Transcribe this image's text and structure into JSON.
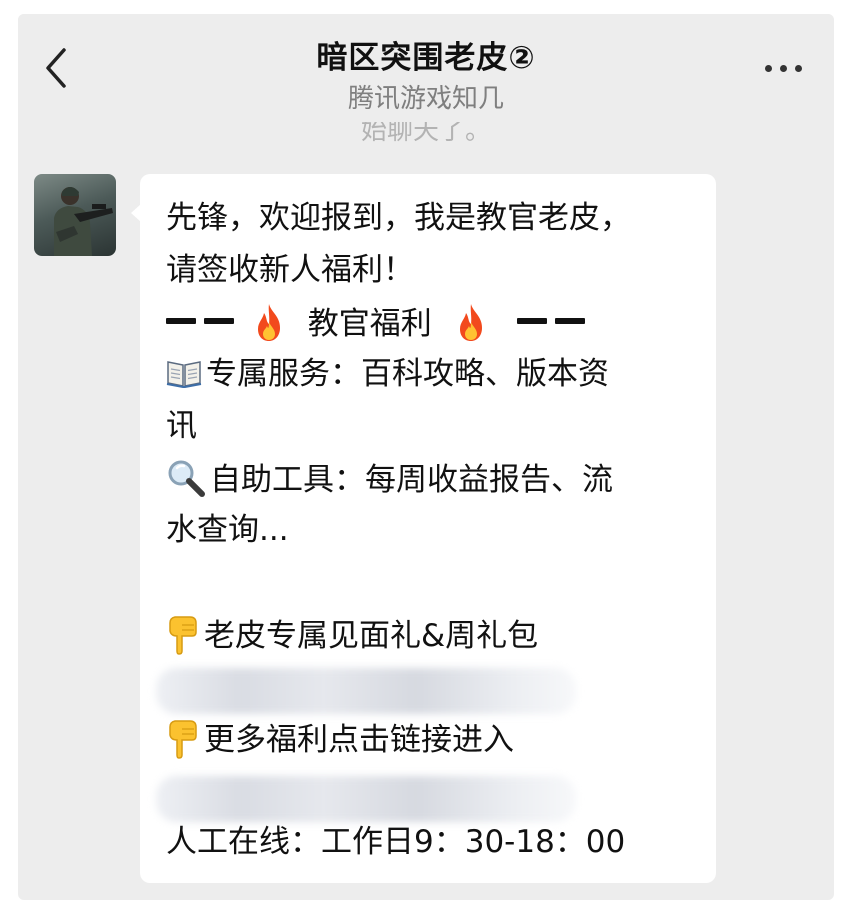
{
  "header": {
    "title": "暗区突围老皮②",
    "subtitle": "腾讯游戏知几"
  },
  "system_message": "始聊天了。",
  "message": {
    "lines": [
      "先锋，欢迎报到，我是教官老皮，",
      "请签收新人福利！",
      "教官福利",
      "专属服务：百科攻略、版本资",
      "讯",
      "自助工具：每周收益报告、流",
      "水查询...",
      "老皮专属见面礼&周礼包",
      "更多福利点击链接进入",
      "人工在线：工作日9：30-18：00"
    ],
    "emoji": {
      "book": "open-book-icon",
      "magnifier": "magnifying-glass-icon",
      "hand": "pointing-down-icon",
      "fire": "fire-icon"
    }
  },
  "colors": {
    "background": "#ededed",
    "bubble": "#ffffff",
    "subtitle": "#7f7f7f"
  }
}
